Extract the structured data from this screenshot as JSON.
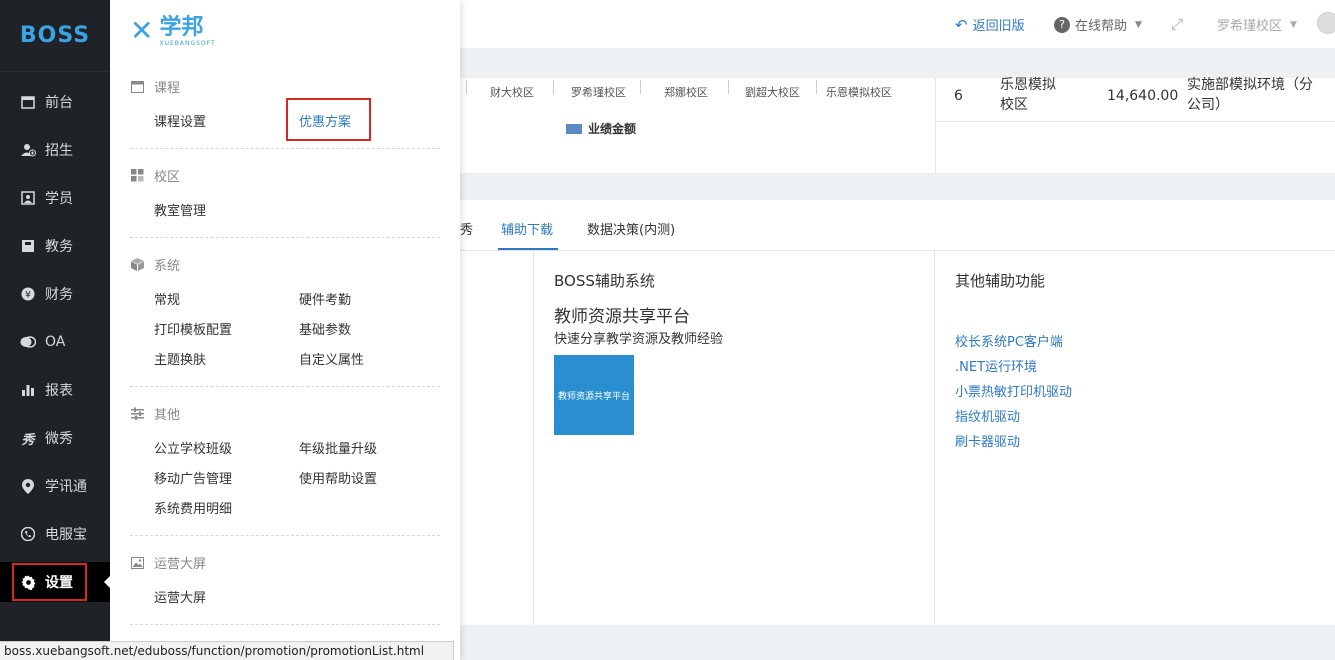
{
  "sidebar": {
    "logo": "BOSS",
    "items": [
      {
        "label": "前台",
        "icon": "calendar-icon"
      },
      {
        "label": "招生",
        "icon": "user-add-icon"
      },
      {
        "label": "学员",
        "icon": "student-icon"
      },
      {
        "label": "教务",
        "icon": "book-icon"
      },
      {
        "label": "财务",
        "icon": "yen-icon"
      },
      {
        "label": "OA",
        "icon": "chat-icon"
      },
      {
        "label": "报表",
        "icon": "bar-chart-icon"
      },
      {
        "label": "微秀",
        "icon": "weixiu-icon"
      },
      {
        "label": "学讯通",
        "icon": "location-pin-icon"
      },
      {
        "label": "电服宝",
        "icon": "phone-icon"
      },
      {
        "label": "设置",
        "icon": "gear-icon",
        "active": true
      }
    ]
  },
  "menu": {
    "brand_cn": "学邦",
    "brand_en": "XUEBANGSOFT",
    "sections": {
      "course": {
        "title": "课程",
        "links": [
          "课程设置",
          "优惠方案"
        ]
      },
      "campus": {
        "title": "校区",
        "links": [
          "教室管理"
        ]
      },
      "system": {
        "title": "系统",
        "links": [
          "常规",
          "硬件考勤",
          "打印模板配置",
          "基础参数",
          "主题换肤",
          "自定义属性"
        ]
      },
      "other": {
        "title": "其他",
        "links": [
          "公立学校班级",
          "年级批量升级",
          "移动广告管理",
          "使用帮助设置",
          "系统费用明细"
        ]
      },
      "ops": {
        "title": "运营大屏",
        "links": [
          "运营大屏"
        ]
      }
    }
  },
  "topbar": {
    "back_label": "返回旧版",
    "help_label": "在线帮助",
    "campus_label": "罗希瑾校区"
  },
  "chart": {
    "categories": [
      "财大校区",
      "罗希瑾校区",
      "郑娜校区",
      "劉超大校区",
      "乐恩模拟校区"
    ],
    "legend": "业绩金额"
  },
  "ranking_row": {
    "rank": "6",
    "campus": "乐恩模拟\n校区",
    "amount": "14,640.00",
    "org": "实施部模拟环境（分\n公司）"
  },
  "tabs": [
    "秀",
    "辅助下载",
    "数据决策(内测)"
  ],
  "boss_aux": {
    "title": "BOSS辅助系统",
    "subtitle": "教师资源共享平台",
    "desc": "快速分享教学资源及教师经验",
    "thumb_text": "教师资源共享平台"
  },
  "other_aux": {
    "title": "其他辅助功能",
    "links": [
      "校长系统PC客户端",
      ".NET运行环境",
      "小票热敏打印机驱动",
      "指纹机驱动",
      "刷卡器驱动"
    ]
  },
  "status_url": "boss.xuebangsoft.net/eduboss/function/promotion/promotionList.html",
  "colors": {
    "accent": "#2f78c4",
    "sidebar": "#1f2226",
    "highlight": "#d72626",
    "legend": "#5b89c2"
  }
}
